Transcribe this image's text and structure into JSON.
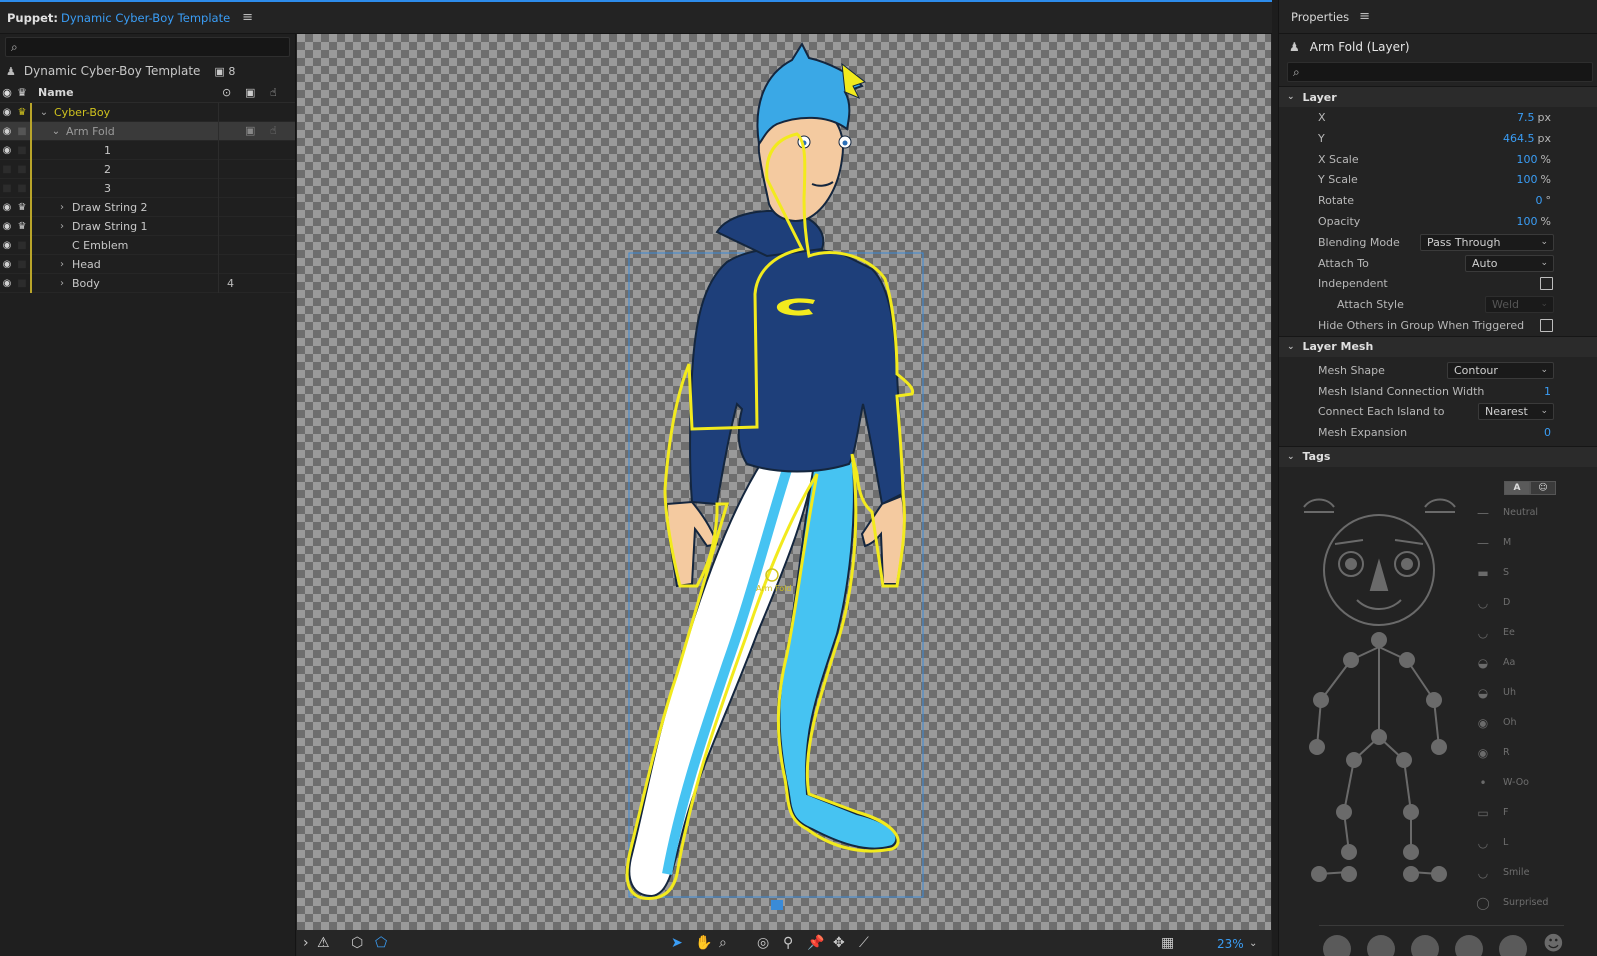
{
  "puppet_panel": {
    "title_prefix": "Puppet:",
    "title_name": "Dynamic Cyber-Boy Template",
    "menu_icon": "hamburger-icon",
    "search_placeholder": "",
    "puppet_name": "Dynamic Cyber-Boy Template",
    "puppet_count": "8",
    "name_header": "Name",
    "layers": [
      {
        "label": "Cyber-Boy",
        "expanded": true,
        "color": "#cfc21e"
      },
      {
        "label": "Arm Fold",
        "expanded": true,
        "selected": true
      },
      {
        "label": "1"
      },
      {
        "label": "2"
      },
      {
        "label": "3"
      },
      {
        "label": "Draw String 2",
        "expanded": false
      },
      {
        "label": "Draw String 1",
        "expanded": false
      },
      {
        "label": "C Emblem"
      },
      {
        "label": "Head",
        "expanded": false
      },
      {
        "label": "Body",
        "expanded": false,
        "count": "4"
      }
    ]
  },
  "canvas": {
    "handle_label": "Arm Fold",
    "zoom": "23%"
  },
  "properties": {
    "header": "Properties",
    "title": "Arm Fold (Layer)",
    "search_placeholder": "",
    "layer_section": {
      "title": "Layer",
      "x_label": "X",
      "x_value": "7.5",
      "x_unit": "px",
      "y_label": "Y",
      "y_value": "464.5",
      "y_unit": "px",
      "xscale_label": "X Scale",
      "xscale_value": "100",
      "xscale_unit": "%",
      "yscale_label": "Y Scale",
      "yscale_value": "100",
      "yscale_unit": "%",
      "rotate_label": "Rotate",
      "rotate_value": "0",
      "rotate_unit": "°",
      "opacity_label": "Opacity",
      "opacity_value": "100",
      "opacity_unit": "%",
      "blending_label": "Blending Mode",
      "blending_value": "Pass Through",
      "attach_label": "Attach To",
      "attach_value": "Auto",
      "independent_label": "Independent",
      "attach_style_label": "Attach Style",
      "attach_style_value": "Weld",
      "hide_label": "Hide Others in Group When Triggered"
    },
    "mesh_section": {
      "title": "Layer Mesh",
      "shape_label": "Mesh Shape",
      "shape_value": "Contour",
      "island_label": "Mesh Island Connection Width",
      "island_value": "1",
      "connect_label": "Connect Each Island to",
      "connect_value": "Nearest",
      "expansion_label": "Mesh Expansion",
      "expansion_value": "0"
    },
    "tags_section": {
      "title": "Tags",
      "toggle_a": "A",
      "mouth_tags": [
        "Neutral",
        "M",
        "S",
        "D",
        "Ee",
        "Aa",
        "Uh",
        "Oh",
        "R",
        "W-Oo",
        "F",
        "L",
        "Smile",
        "Surprised"
      ]
    }
  },
  "colors": {
    "accent": "#3a9df5",
    "selection_yellow": "#f2ea1d",
    "shirt": "#1e3f7a",
    "pants": "#46c3f2"
  }
}
